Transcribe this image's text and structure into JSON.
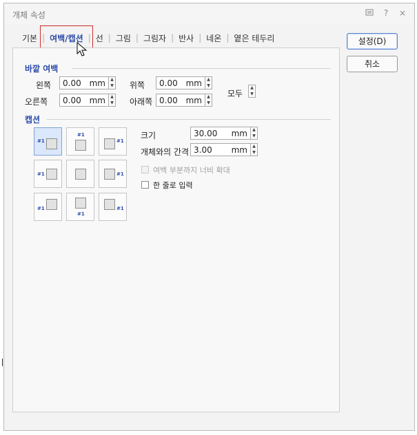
{
  "window": {
    "title": "개체 속성",
    "icons": [
      "window-icon",
      "help-icon",
      "close-icon"
    ],
    "help_glyph": "?",
    "close_glyph": "×"
  },
  "tabs": [
    {
      "label": "기본",
      "active": false
    },
    {
      "label": "여백/캡션",
      "active": true
    },
    {
      "label": "선",
      "active": false
    },
    {
      "label": "그림",
      "active": false
    },
    {
      "label": "그림자",
      "active": false
    },
    {
      "label": "반사",
      "active": false
    },
    {
      "label": "네온",
      "active": false
    },
    {
      "label": "옅은 테두리",
      "active": false
    }
  ],
  "buttons": {
    "ok": "설정(D)",
    "cancel": "취소"
  },
  "margin": {
    "section": "바깥 여백",
    "left": {
      "label": "왼쪽",
      "value": "0.00",
      "unit": "mm"
    },
    "right": {
      "label": "오른쪽",
      "value": "0.00",
      "unit": "mm"
    },
    "top": {
      "label": "위쪽",
      "value": "0.00",
      "unit": "mm"
    },
    "bottom": {
      "label": "아래쪽",
      "value": "0.00",
      "unit": "mm"
    },
    "all": "모두"
  },
  "caption": {
    "section": "캡션",
    "tag": "#1",
    "size": {
      "label": "크기",
      "value": "30.00",
      "unit": "mm"
    },
    "gap": {
      "label": "개체와의 간격",
      "value": "3.00",
      "unit": "mm"
    },
    "expand": {
      "label": "여백 부분까지 너비 확대",
      "checked": false,
      "enabled": false
    },
    "single_line": {
      "label": "한 줄로 입력",
      "checked": false,
      "enabled": true
    },
    "selected_position": "left-top"
  },
  "colors": {
    "accent": "#2b4aa8",
    "highlight": "#cc2a2a",
    "selected": "#dbe7fb"
  }
}
